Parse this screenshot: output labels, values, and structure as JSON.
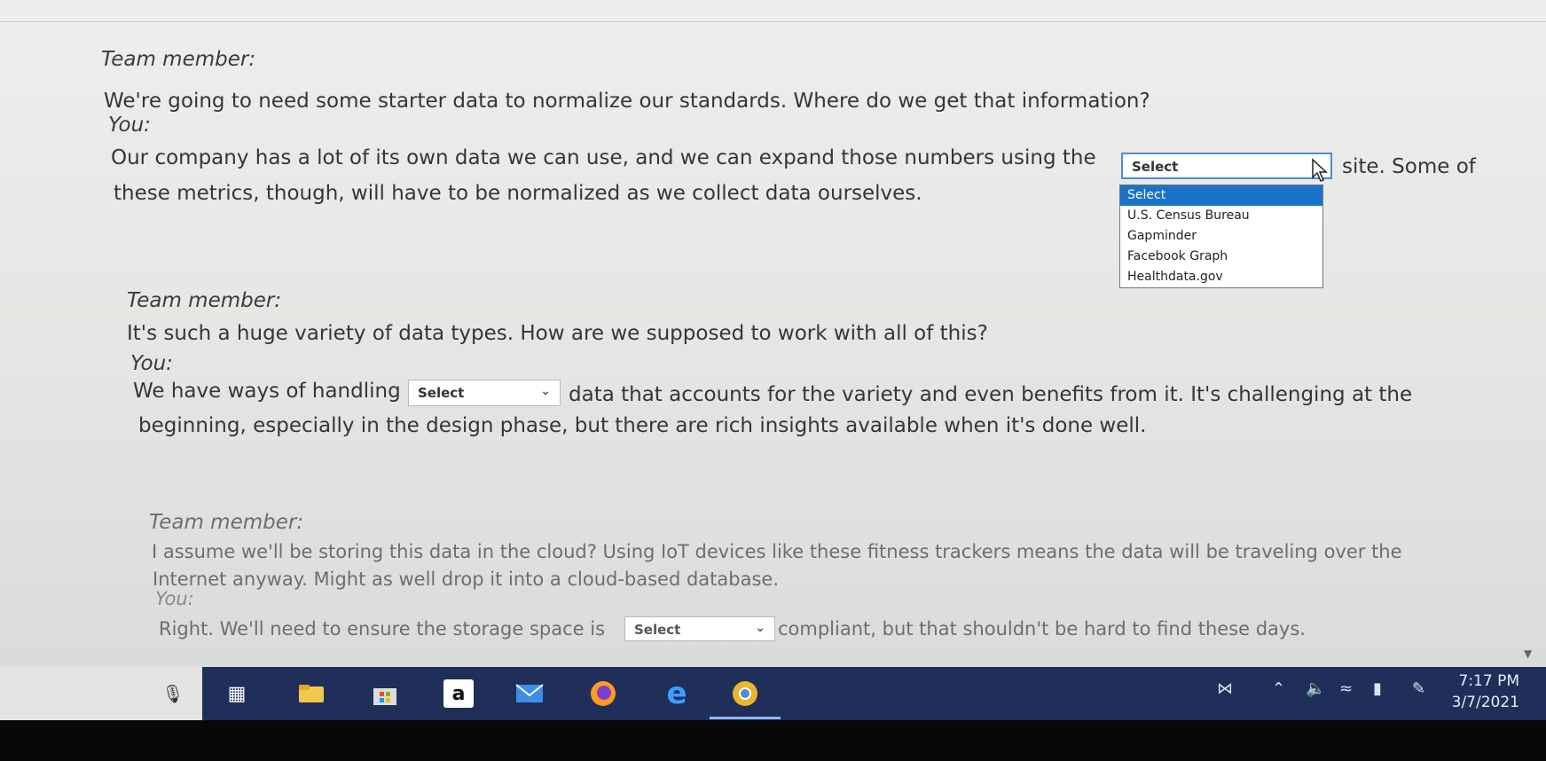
{
  "dialogue": {
    "block1": {
      "member_label": "Team member:",
      "member_text": "We're going to need some starter data to normalize our standards. Where do we get that information?",
      "you_label": "You:",
      "you_text_before": "Our company has a lot of its own data we can use, and we can expand those numbers using the",
      "you_text_after": "site. Some of",
      "you_text_line2": "these metrics, though, will have to be normalized as we collect data ourselves.",
      "select_value": "Select",
      "dropdown_options": [
        "Select",
        "U.S. Census Bureau",
        "Gapminder",
        "Facebook Graph",
        "Healthdata.gov"
      ]
    },
    "block2": {
      "member_label": "Team member:",
      "member_text": "It's such a huge variety of data types. How are we supposed to work with all of this?",
      "you_label": "You:",
      "you_text_before": "We have ways of handling",
      "select_value": "Select",
      "you_text_after": "data that accounts for the variety and even benefits from it. It's challenging at the",
      "you_text_line2": "beginning, especially in the design phase, but there are rich insights available when it's done well."
    },
    "block3": {
      "member_label": "Team member:",
      "member_text_line1": "I assume we'll be storing this data in the cloud? Using IoT devices like these fitness trackers means the data will be traveling over the",
      "member_text_line2": "Internet anyway. Might as well drop it into a cloud-based database.",
      "you_label": "You:",
      "you_text_before": "Right. We'll need to ensure the storage space is",
      "select_value": "Select",
      "you_text_after": "compliant, but that shouldn't be hard to find these days."
    }
  },
  "taskbar": {
    "apps": [
      "microphone-icon",
      "task-view-icon",
      "file-explorer-icon",
      "store-icon",
      "amazon-icon",
      "mail-icon",
      "firefox-icon",
      "edge-icon",
      "chrome-icon"
    ],
    "amazon_glyph": "a",
    "edge_glyph": "e",
    "clock_time": "7:17 PM",
    "clock_date": "3/7/2021"
  },
  "colors": {
    "taskbar": "#1f2f5a",
    "dropdown_highlight": "#1a73c8",
    "select_focus": "#4a8fd6"
  }
}
